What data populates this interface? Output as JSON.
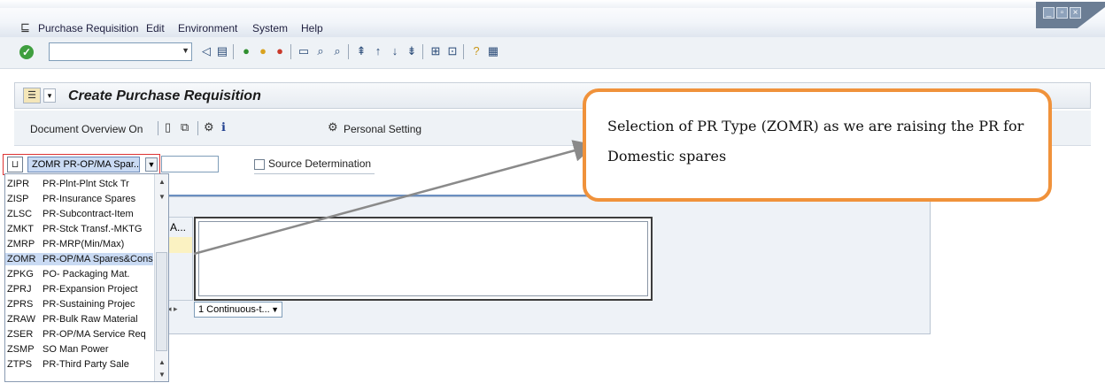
{
  "menu": {
    "items": [
      "Purchase Requisition",
      "Edit",
      "Environment",
      "System",
      "Help"
    ]
  },
  "window": {
    "controls": [
      "minimize",
      "restore",
      "close"
    ]
  },
  "toolbar": {
    "command_value": ""
  },
  "header": {
    "title": "Create Purchase Requisition"
  },
  "app_toolbar": {
    "document_overview": "Document Overview On",
    "personal_setting": "Personal Setting"
  },
  "form": {
    "doc_type_value": "ZOMR PR-OP/MA Spar...",
    "source_determination": "Source Determination"
  },
  "doc_type_options": [
    {
      "code": "ZIPR",
      "label": "PR-Plnt-Plnt Stck Tr"
    },
    {
      "code": "ZISP",
      "label": "PR-Insurance Spares"
    },
    {
      "code": "ZLSC",
      "label": "PR-Subcontract-Item"
    },
    {
      "code": "ZMKT",
      "label": "PR-Stck Transf.-MKTG"
    },
    {
      "code": "ZMRP",
      "label": "PR-MRP(Min/Max)"
    },
    {
      "code": "ZOMR",
      "label": "PR-OP/MA Spares&Cons",
      "selected": true
    },
    {
      "code": "ZPKG",
      "label": "PO- Packaging Mat."
    },
    {
      "code": "ZPRJ",
      "label": "PR-Expansion Project"
    },
    {
      "code": "ZPRS",
      "label": "PR-Sustaining Projec"
    },
    {
      "code": "ZRAW",
      "label": "PR-Bulk Raw Material"
    },
    {
      "code": "ZSER",
      "label": "PR-OP/MA Service Req"
    },
    {
      "code": "ZSMP",
      "label": "SO Man Power"
    },
    {
      "code": "ZTPS",
      "label": "PR-Third Party Sale"
    }
  ],
  "grid": {
    "col_header": "A...",
    "layout_value": "1 Continuous-t..."
  },
  "callout": {
    "text": "Selection of PR Type (ZOMR) as we are raising the PR for Domestic spares",
    "border_color": "#f0923b"
  }
}
